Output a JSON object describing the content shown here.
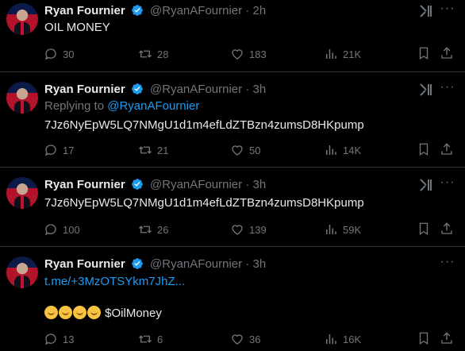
{
  "tweets": [
    {
      "name": "Ryan Fournier",
      "handle": "@RyanAFournier",
      "dot": "·",
      "time": "2h",
      "text": "OIL MONEY",
      "replies": "30",
      "reposts": "28",
      "likes": "183",
      "views": "21K",
      "has_grok": true
    },
    {
      "name": "Ryan Fournier",
      "handle": "@RyanAFournier",
      "dot": "·",
      "time": "3h",
      "replying_label": "Replying to",
      "replying_handle": "@RyanAFournier",
      "text": "7Jz6NyEpW5LQ7NMgU1d1m4efLdZTBzn4zumsD8HKpump",
      "replies": "17",
      "reposts": "21",
      "likes": "50",
      "views": "14K",
      "has_grok": true
    },
    {
      "name": "Ryan Fournier",
      "handle": "@RyanAFournier",
      "dot": "·",
      "time": "3h",
      "text": "7Jz6NyEpW5LQ7NMgU1d1m4efLdZTBzn4zumsD8HKpump",
      "replies": "100",
      "reposts": "26",
      "likes": "139",
      "views": "59K",
      "has_grok": true
    },
    {
      "name": "Ryan Fournier",
      "handle": "@RyanAFournier",
      "dot": "·",
      "time": "3h",
      "link": "t.me/+3MzOTSYkm7JhZ...",
      "text": "$OilMoney",
      "emoji_count": 4,
      "replies": "13",
      "reposts": "6",
      "likes": "36",
      "views": "16K",
      "has_grok": false
    }
  ],
  "colors": {
    "background": "#000000",
    "text": "#e7e9ea",
    "muted": "#71767b",
    "link": "#1d9bf0",
    "verified": "#1d9bf0",
    "divider": "#2f3336"
  },
  "icons": {
    "verified": "verified-badge-icon",
    "grok": "grok-icon",
    "more": "more-icon",
    "reply": "reply-icon",
    "repost": "repost-icon",
    "like": "like-icon",
    "views": "views-icon",
    "bookmark": "bookmark-icon",
    "share": "share-icon"
  }
}
